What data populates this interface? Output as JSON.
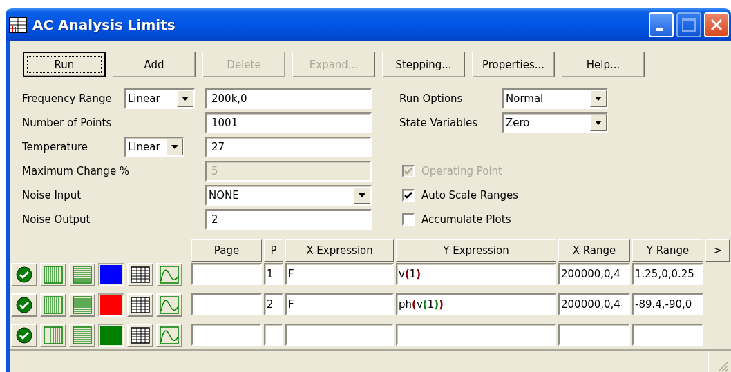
{
  "window": {
    "title": "AC Analysis Limits"
  },
  "toolbar": [
    {
      "label": "Run",
      "default": true,
      "disabled": false
    },
    {
      "label": "Add",
      "default": false,
      "disabled": false
    },
    {
      "label": "Delete",
      "default": false,
      "disabled": true
    },
    {
      "label": "Expand...",
      "default": false,
      "disabled": true
    },
    {
      "label": "Stepping...",
      "default": false,
      "disabled": false
    },
    {
      "label": "Properties...",
      "default": false,
      "disabled": false
    },
    {
      "label": "Help...",
      "default": false,
      "disabled": false
    }
  ],
  "left_fields": [
    {
      "label": "Frequency Range",
      "select": "Linear",
      "kind": "text",
      "value": "200k,0",
      "disabled": false
    },
    {
      "label": "Number of Points",
      "kind": "text",
      "value": "1001",
      "disabled": false
    },
    {
      "label": "Temperature",
      "select": "Linear",
      "kind": "text",
      "value": "27",
      "disabled": false
    },
    {
      "label": "Maximum Change %",
      "kind": "text",
      "value": "5",
      "disabled": true
    },
    {
      "label": "Noise Input",
      "kind": "dropdown",
      "value": "NONE",
      "disabled": false
    },
    {
      "label": "Noise Output",
      "kind": "text",
      "value": "2",
      "disabled": false
    }
  ],
  "right_options": [
    {
      "label": "Run Options",
      "value": "Normal"
    },
    {
      "label": "State Variables",
      "value": "Zero"
    }
  ],
  "checkboxes": [
    {
      "label": "Operating Point",
      "checked": true,
      "disabled": true
    },
    {
      "label": "Auto Scale Ranges",
      "checked": true,
      "disabled": false
    },
    {
      "label": "Accumulate Plots",
      "checked": false,
      "disabled": false
    }
  ],
  "table": {
    "columns": [
      "Page",
      "P",
      "X Expression",
      "Y Expression",
      "X Range",
      "Y Range"
    ],
    "more_button": ">",
    "rows": [
      {
        "enabled": true,
        "x_grid_fine": true,
        "color": "#0000ff",
        "p": "1",
        "x_expression": "F",
        "y_expression": [
          {
            "text": "v"
          },
          {
            "text": "(",
            "color": "#800000"
          },
          {
            "text": "1"
          },
          {
            "text": ")",
            "color": "#800000"
          }
        ],
        "x_range": "200000,0,4",
        "y_range": "1.25,0,0.25"
      },
      {
        "enabled": true,
        "x_grid_fine": true,
        "color": "#ff0000",
        "p": "2",
        "x_expression": "F",
        "y_expression": [
          {
            "text": "ph"
          },
          {
            "text": "(",
            "color": "#800000"
          },
          {
            "text": "v"
          },
          {
            "text": "(",
            "color": "#008000"
          },
          {
            "text": "1"
          },
          {
            "text": ")",
            "color": "#008000"
          },
          {
            "text": ")",
            "color": "#800000"
          }
        ],
        "x_range": "200000,0,4",
        "y_range": "-89.4,-90,0"
      },
      {
        "enabled": true,
        "x_grid_fine": false,
        "color": "#008000"
      }
    ]
  }
}
